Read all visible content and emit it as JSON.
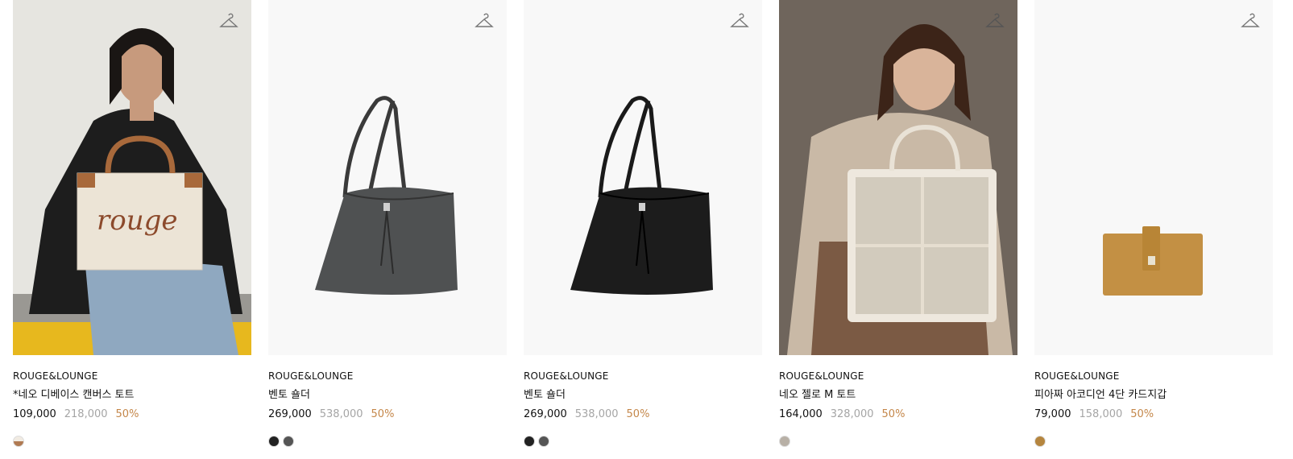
{
  "products": [
    {
      "brand": "ROUGE&LOUNGE",
      "name": "*네오 디베이스 캔버스 토트",
      "price": "109,000",
      "original_price": "218,000",
      "discount": "50%",
      "image_kind": "model-canvas-tote",
      "swatches": [
        "#b07a52"
      ]
    },
    {
      "brand": "ROUGE&LOUNGE",
      "name": "벤토 숄더",
      "price": "269,000",
      "original_price": "538,000",
      "discount": "50%",
      "image_kind": "bucket-bag-grey",
      "swatches": [
        "#222222",
        "#555555"
      ]
    },
    {
      "brand": "ROUGE&LOUNGE",
      "name": "벤토 숄더",
      "price": "269,000",
      "original_price": "538,000",
      "discount": "50%",
      "image_kind": "bucket-bag-black",
      "swatches": [
        "#222222",
        "#555555"
      ]
    },
    {
      "brand": "ROUGE&LOUNGE",
      "name": "네오 젤로 M 토트",
      "price": "164,000",
      "original_price": "328,000",
      "discount": "50%",
      "image_kind": "model-shearling-tote",
      "swatches": [
        "#b8b0a6"
      ]
    },
    {
      "brand": "ROUGE&LOUNGE",
      "name": "피아짜 아코디언 4단 카드지갑",
      "price": "79,000",
      "original_price": "158,000",
      "discount": "50%",
      "image_kind": "card-wallet-tan",
      "swatches": [
        "#b5853e"
      ]
    }
  ],
  "colors": {
    "discount": "#c4874a",
    "original_price": "#a5a5a5"
  },
  "icons": {
    "wishlist": "hanger-icon"
  }
}
